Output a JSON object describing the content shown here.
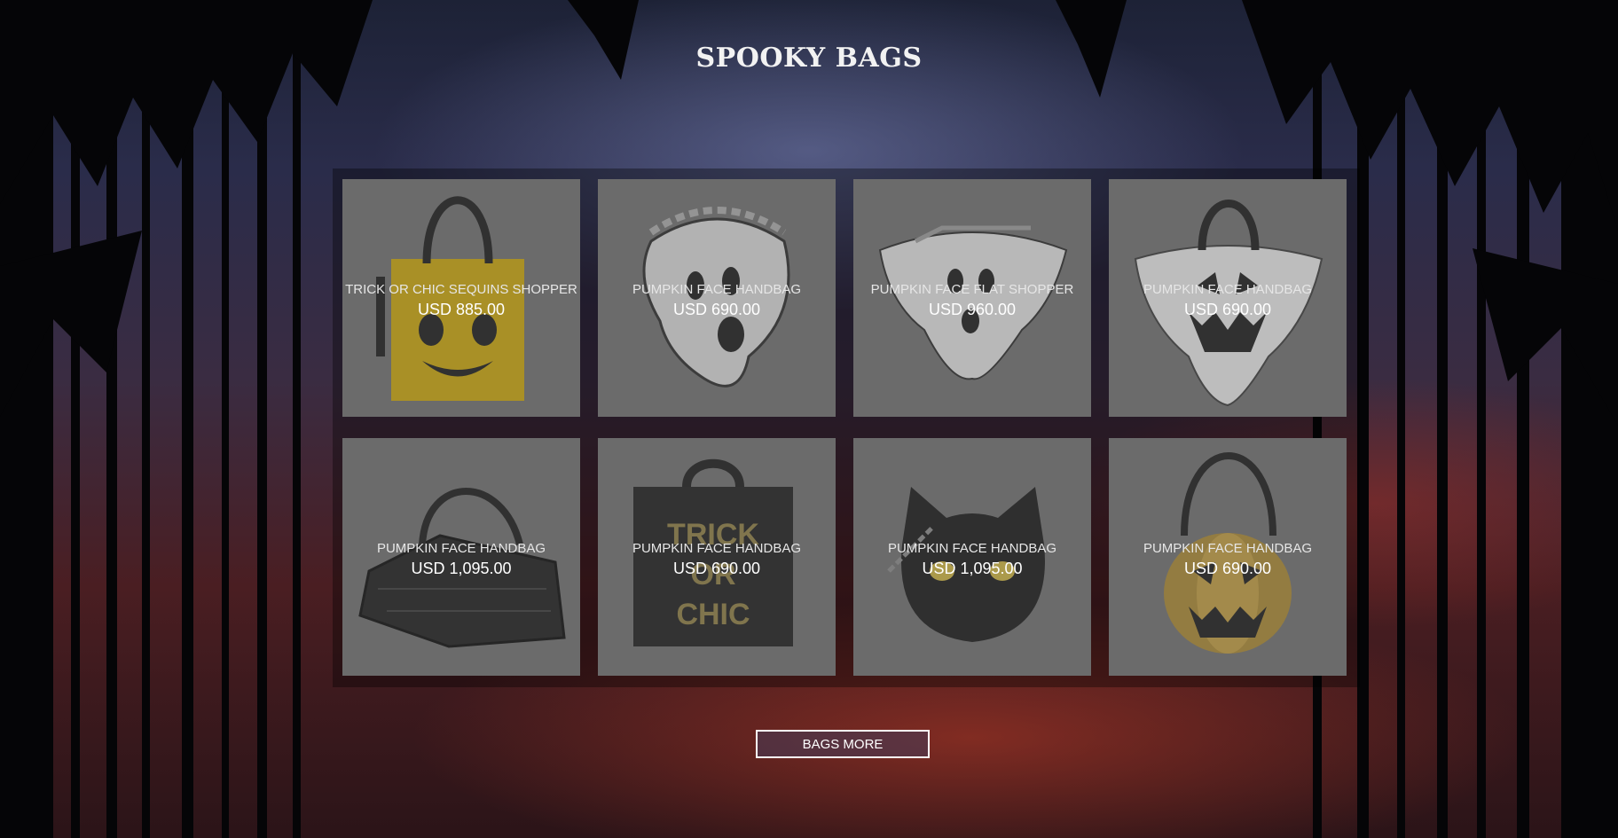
{
  "page": {
    "title": "SPOOKY BAGS"
  },
  "products": [
    {
      "name": "TRICK OR CHIC SEQUINS SHOPPER",
      "price": "USD 885.00",
      "icon": "yellow-pumpkin-tote-icon"
    },
    {
      "name": "PUMPKIN FACE HANDBAG",
      "price": "USD 690.00",
      "icon": "ghost-bag-icon"
    },
    {
      "name": "PUMPKIN FACE FLAT SHOPPER",
      "price": "USD 960.00",
      "icon": "ghost-flat-shopper-icon"
    },
    {
      "name": "PUMPKIN FACE HANDBAG",
      "price": "USD 690.00",
      "icon": "white-jackolantern-bag-icon"
    },
    {
      "name": "PUMPKIN FACE HANDBAG",
      "price": "USD 1,095.00",
      "icon": "coffin-bag-icon"
    },
    {
      "name": "PUMPKIN FACE HANDBAG",
      "price": "USD 690.00",
      "icon": "trick-or-chic-bag-icon"
    },
    {
      "name": "PUMPKIN FACE HANDBAG",
      "price": "USD 1,095.00",
      "icon": "cat-bag-icon"
    },
    {
      "name": "PUMPKIN FACE HANDBAG",
      "price": "USD 690.00",
      "icon": "gold-pumpkin-bag-icon"
    }
  ],
  "bag_art_text": {
    "line1": "TRICK",
    "line2": "OR",
    "line3": "CHIC"
  },
  "actions": {
    "more_label": "BAGS MORE"
  },
  "colors": {
    "card_bg": "#6b6b6b",
    "title": "#f2f2f2",
    "button_border": "#ffffff"
  }
}
